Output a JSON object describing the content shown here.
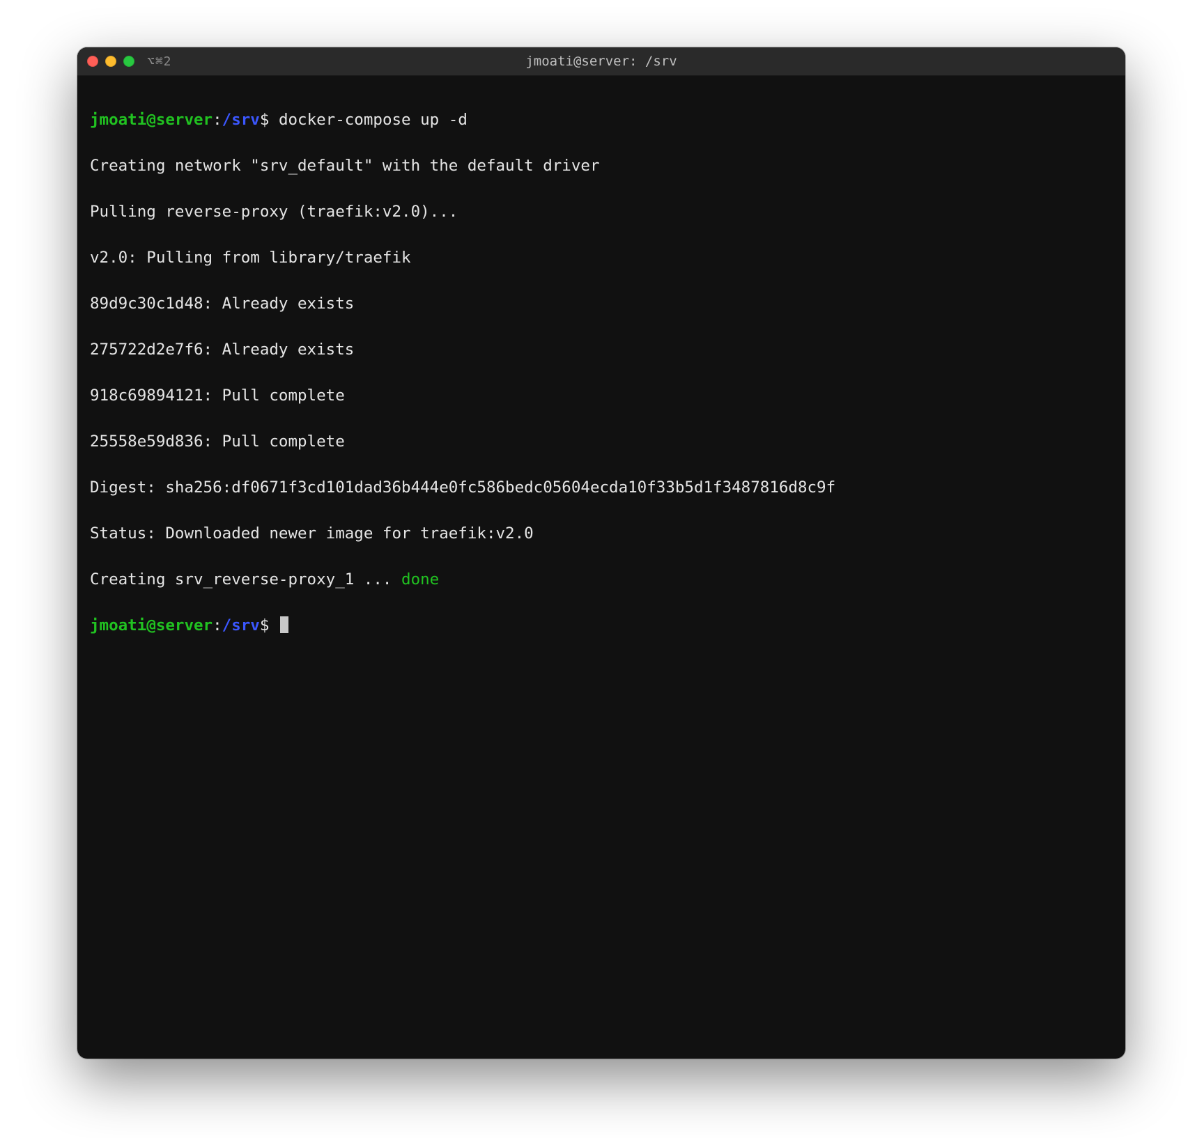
{
  "titlebar": {
    "tab_indicator": "⌥⌘2",
    "title": "jmoati@server: /srv"
  },
  "prompt": {
    "user_host": "jmoati@server",
    "colon": ":",
    "path": "/srv",
    "symbol": "$"
  },
  "session": {
    "cmd1": "docker-compose up -d",
    "lines": [
      "Creating network \"srv_default\" with the default driver",
      "Pulling reverse-proxy (traefik:v2.0)...",
      "v2.0: Pulling from library/traefik",
      "89d9c30c1d48: Already exists",
      "275722d2e7f6: Already exists",
      "918c69894121: Pull complete",
      "25558e59d836: Pull complete",
      "Digest: sha256:df0671f3cd101dad36b444e0fc586bedc05604ecda10f33b5d1f3487816d8c9f",
      "Status: Downloaded newer image for traefik:v2.0"
    ],
    "creating_prefix": "Creating srv_reverse-proxy_1 ... ",
    "creating_status": "done"
  }
}
